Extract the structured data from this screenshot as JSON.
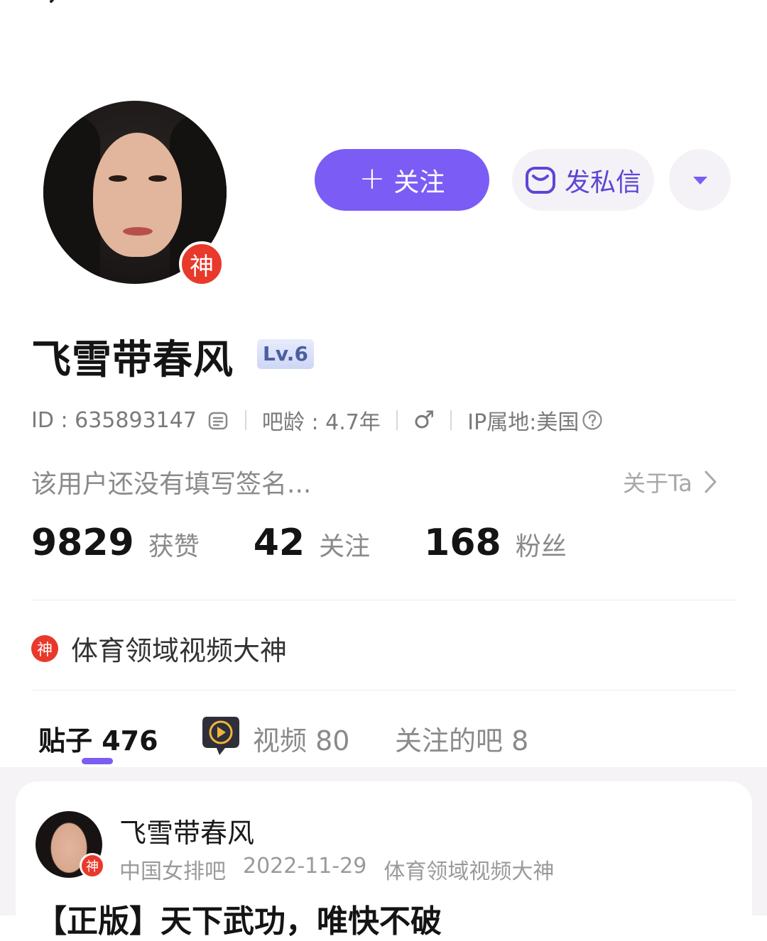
{
  "profile": {
    "avatar_badge": "神",
    "follow_label": "关注",
    "follow_plus": "+",
    "message_label": "发私信",
    "username": "飞雪带春风",
    "level": "Lv.6",
    "id_text": "ID : 635893147",
    "age_text": "吧龄 : 4.7年",
    "gender_symbol": "♂",
    "ip_text": "IP属地:美国",
    "bio": "该用户还没有填写签名...",
    "about_label": "关于Ta",
    "title_badge": "神",
    "title": "体育领域视频大神"
  },
  "stats": [
    {
      "value": "9829",
      "label": "获赞"
    },
    {
      "value": "42",
      "label": "关注"
    },
    {
      "value": "168",
      "label": "粉丝"
    }
  ],
  "tabs": [
    {
      "label": "贴子 476"
    },
    {
      "label": "视频 80"
    },
    {
      "label": "关注的吧 8"
    }
  ],
  "post": {
    "author": "飞雪带春风",
    "badge": "神",
    "forum": "中国女排吧",
    "date": "2022-11-29",
    "author_title": "体育领域视频大神",
    "title": "【正版】天下武功，唯快不破"
  },
  "colors": {
    "accent": "#7b5cf5",
    "badge_red": "#e8392b",
    "message_text": "#5d46d6"
  },
  "icons": [
    "back-arrow-icon",
    "mail-icon",
    "caret-down-icon",
    "copy-icon",
    "male-icon",
    "help-icon",
    "chevron-right-icon",
    "video-play-icon"
  ]
}
